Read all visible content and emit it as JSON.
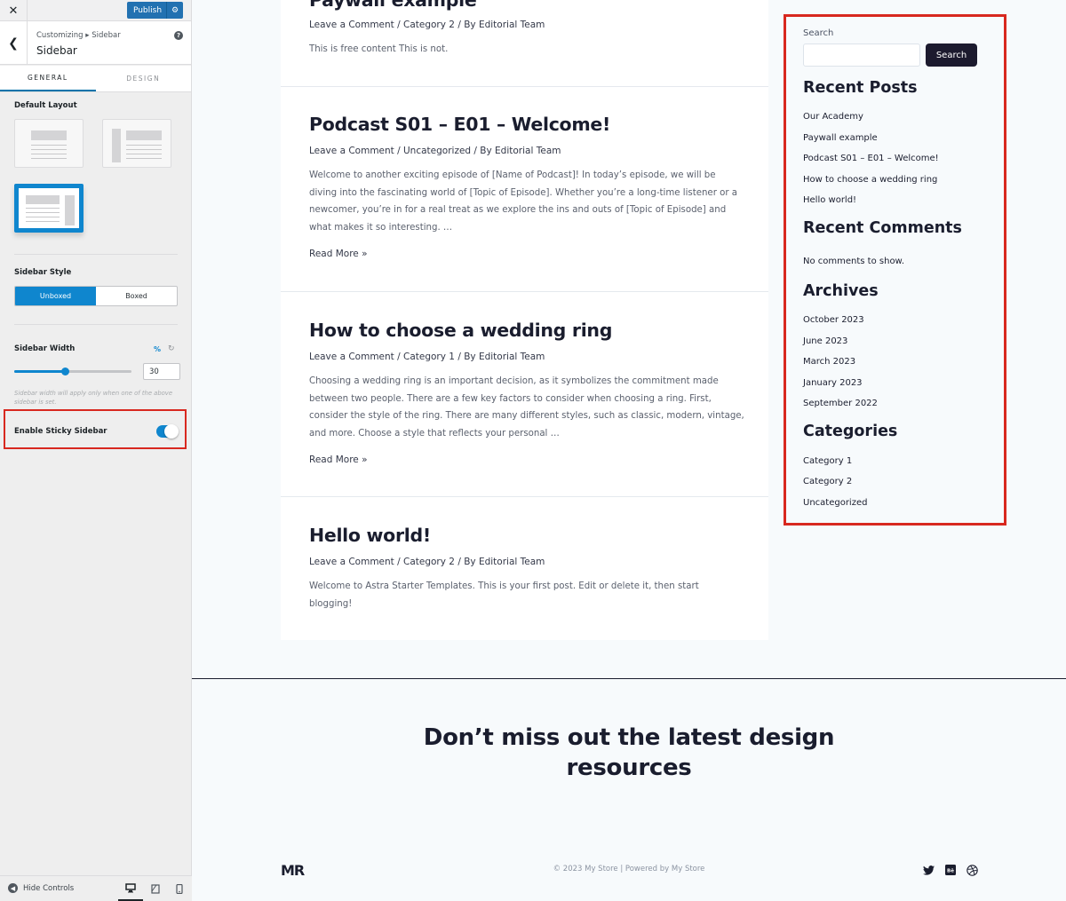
{
  "panel": {
    "publish_label": "Publish",
    "breadcrumb": "Customizing ▸ Sidebar",
    "title": "Sidebar",
    "tabs": [
      "GENERAL",
      "DESIGN"
    ],
    "default_layout_label": "Default Layout",
    "sidebar_style_label": "Sidebar Style",
    "sidebar_style_options": [
      "Unboxed",
      "Boxed"
    ],
    "sidebar_style_selected": "Unboxed",
    "sidebar_width_label": "Sidebar Width",
    "sidebar_width_unit": "%",
    "sidebar_width_value": "30",
    "sidebar_width_fraction": 0.3,
    "sidebar_width_note": "Sidebar width will apply only when one of the above sidebar is set.",
    "sticky_label": "Enable Sticky Sidebar",
    "sticky_enabled": true,
    "hide_controls": "Hide Controls"
  },
  "posts": [
    {
      "title": "Paywall example",
      "meta": "Leave a Comment / Category 2 / By Editorial Team",
      "excerpt": "This is free content This is not."
    },
    {
      "title": "Podcast S01 – E01 – Welcome!",
      "meta": "Leave a Comment / Uncategorized / By Editorial Team",
      "excerpt": "Welcome to another exciting episode of [Name of Podcast]! In today’s episode, we will be diving into the fascinating world of [Topic of Episode]. Whether you’re a long-time listener or a newcomer, you’re in for a real treat as we explore the ins and outs of [Topic of Episode] and what makes it so interesting. …",
      "read_more": "Read More »"
    },
    {
      "title": "How to choose a wedding ring",
      "meta": "Leave a Comment / Category 1 / By Editorial Team",
      "excerpt": "Choosing a wedding ring is an important decision, as it symbolizes the commitment made between two people. There are a few key factors to consider when choosing a ring. First, consider the style of the ring. There are many different styles, such as classic, modern, vintage, and more. Choose a style that reflects your personal …",
      "read_more": "Read More »"
    },
    {
      "title": "Hello world!",
      "meta": "Leave a Comment / Category 2 / By Editorial Team",
      "excerpt": "Welcome to Astra Starter Templates. This is your first post. Edit or delete it, then start blogging!"
    }
  ],
  "sidebar": {
    "search_label": "Search",
    "search_button": "Search",
    "recent_posts_heading": "Recent Posts",
    "recent_posts": [
      "Our Academy",
      "Paywall example",
      "Podcast S01 – E01 – Welcome!",
      "How to choose a wedding ring",
      "Hello world!"
    ],
    "recent_comments_heading": "Recent Comments",
    "recent_comments_text": "No comments to show.",
    "archives_heading": "Archives",
    "archives": [
      "October 2023",
      "June 2023",
      "March 2023",
      "January 2023",
      "September 2022"
    ],
    "categories_heading": "Categories",
    "categories": [
      "Category 1",
      "Category 2",
      "Uncategorized"
    ]
  },
  "footer": {
    "cta_line1": "Don’t miss out the latest design",
    "cta_line2": "resources",
    "logo": "MR",
    "copyright": "© 2023 My Store | Powered by My Store"
  },
  "colors": {
    "accent": "#0f86ce",
    "highlight": "#d8281f",
    "dark": "#1c1a2e"
  }
}
